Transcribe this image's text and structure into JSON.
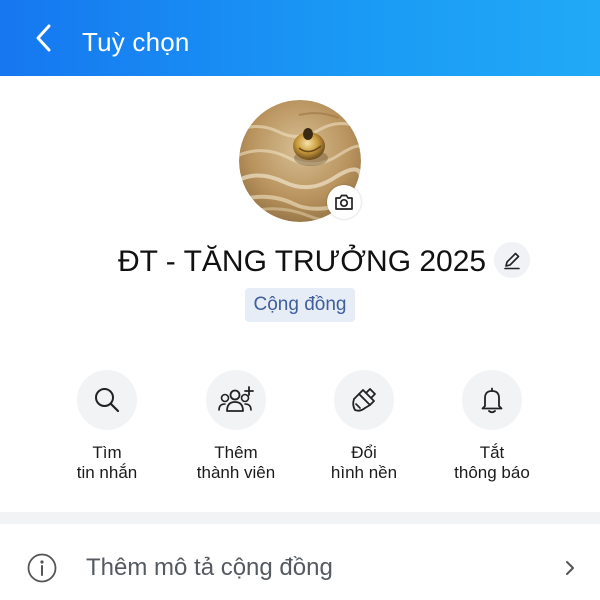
{
  "header": {
    "title": "Tuỳ chọn",
    "back_icon": "chevron-left-icon",
    "background": "#1a8ff3"
  },
  "profile": {
    "avatar": "group-avatar-sand-snail-photo",
    "camera_icon": "camera-icon",
    "name": "ĐT - TĂNG TRƯỞNG 2025",
    "edit_icon": "pencil-icon",
    "badge": "Cộng đồng"
  },
  "actions": [
    {
      "icon": "search-icon",
      "line1": "Tìm",
      "line2": "tin nhắn"
    },
    {
      "icon": "add-members-icon",
      "line1": "Thêm",
      "line2": "thành viên"
    },
    {
      "icon": "paintbrush-icon",
      "line1": "Đổi",
      "line2": "hình nền"
    },
    {
      "icon": "bell-icon",
      "line1": "Tắt",
      "line2": "thông báo"
    }
  ],
  "description_row": {
    "icon": "info-icon",
    "label": "Thêm mô tả cộng đồng",
    "chevron": "chevron-right-icon"
  }
}
